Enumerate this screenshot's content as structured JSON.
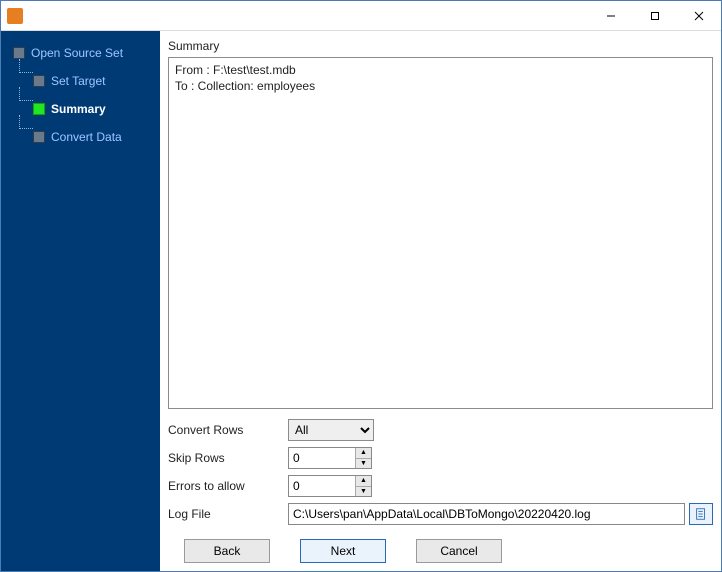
{
  "window": {
    "title": ""
  },
  "sidebar": {
    "items": [
      {
        "label": "Open Source Set",
        "current": false
      },
      {
        "label": "Set Target",
        "current": false
      },
      {
        "label": "Summary",
        "current": true
      },
      {
        "label": "Convert Data",
        "current": false
      }
    ]
  },
  "main": {
    "panel_label": "Summary",
    "summary_text": "From : F:\\test\\test.mdb\nTo : Collection: employees",
    "fields": {
      "convert_rows": {
        "label": "Convert Rows",
        "value": "All",
        "options": [
          "All"
        ]
      },
      "skip_rows": {
        "label": "Skip Rows",
        "value": "0"
      },
      "errors_allow": {
        "label": "Errors to allow",
        "value": "0"
      },
      "log_file": {
        "label": "Log File",
        "value": "C:\\Users\\pan\\AppData\\Local\\DBToMongo\\20220420.log"
      }
    },
    "buttons": {
      "back": "Back",
      "next": "Next",
      "cancel": "Cancel"
    }
  }
}
